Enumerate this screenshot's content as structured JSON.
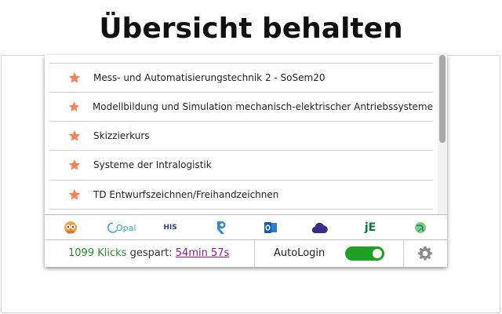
{
  "headline": "Übersicht behalten",
  "courses": [
    {
      "label": "Mess- und Automatisierungstechnik 2 - SoSem20",
      "favorite": true
    },
    {
      "label": "Modellbildung und Simulation mechanisch-elektrischer Antriebssysteme",
      "favorite": true
    },
    {
      "label": "Skizzierkurs",
      "favorite": true
    },
    {
      "label": "Systeme der Intralogistik",
      "favorite": true
    },
    {
      "label": "TD Entwurfszeichnen/Freihandzeichnen",
      "favorite": true
    }
  ],
  "icon_bar": {
    "items": [
      {
        "icon": "owl-mascot-icon"
      },
      {
        "icon": "opal-icon",
        "text": "Opal"
      },
      {
        "icon": "his-icon",
        "text": "HIS"
      },
      {
        "icon": "r-icon"
      },
      {
        "icon": "outlook-icon"
      },
      {
        "icon": "cloud-icon"
      },
      {
        "icon": "je-icon",
        "text": "jE"
      },
      {
        "icon": "globe-icon"
      }
    ]
  },
  "footer": {
    "clicks_count": "1099 Klicks",
    "saved_label": "gespart:",
    "saved_time": "54min 57s",
    "autologin_label": "AutoLogin",
    "autologin_enabled": true
  },
  "colors": {
    "star": "#f2845c",
    "green_text": "#2e8b2e",
    "toggle_on": "#1ea024",
    "link_visited": "#8e1a8e"
  }
}
